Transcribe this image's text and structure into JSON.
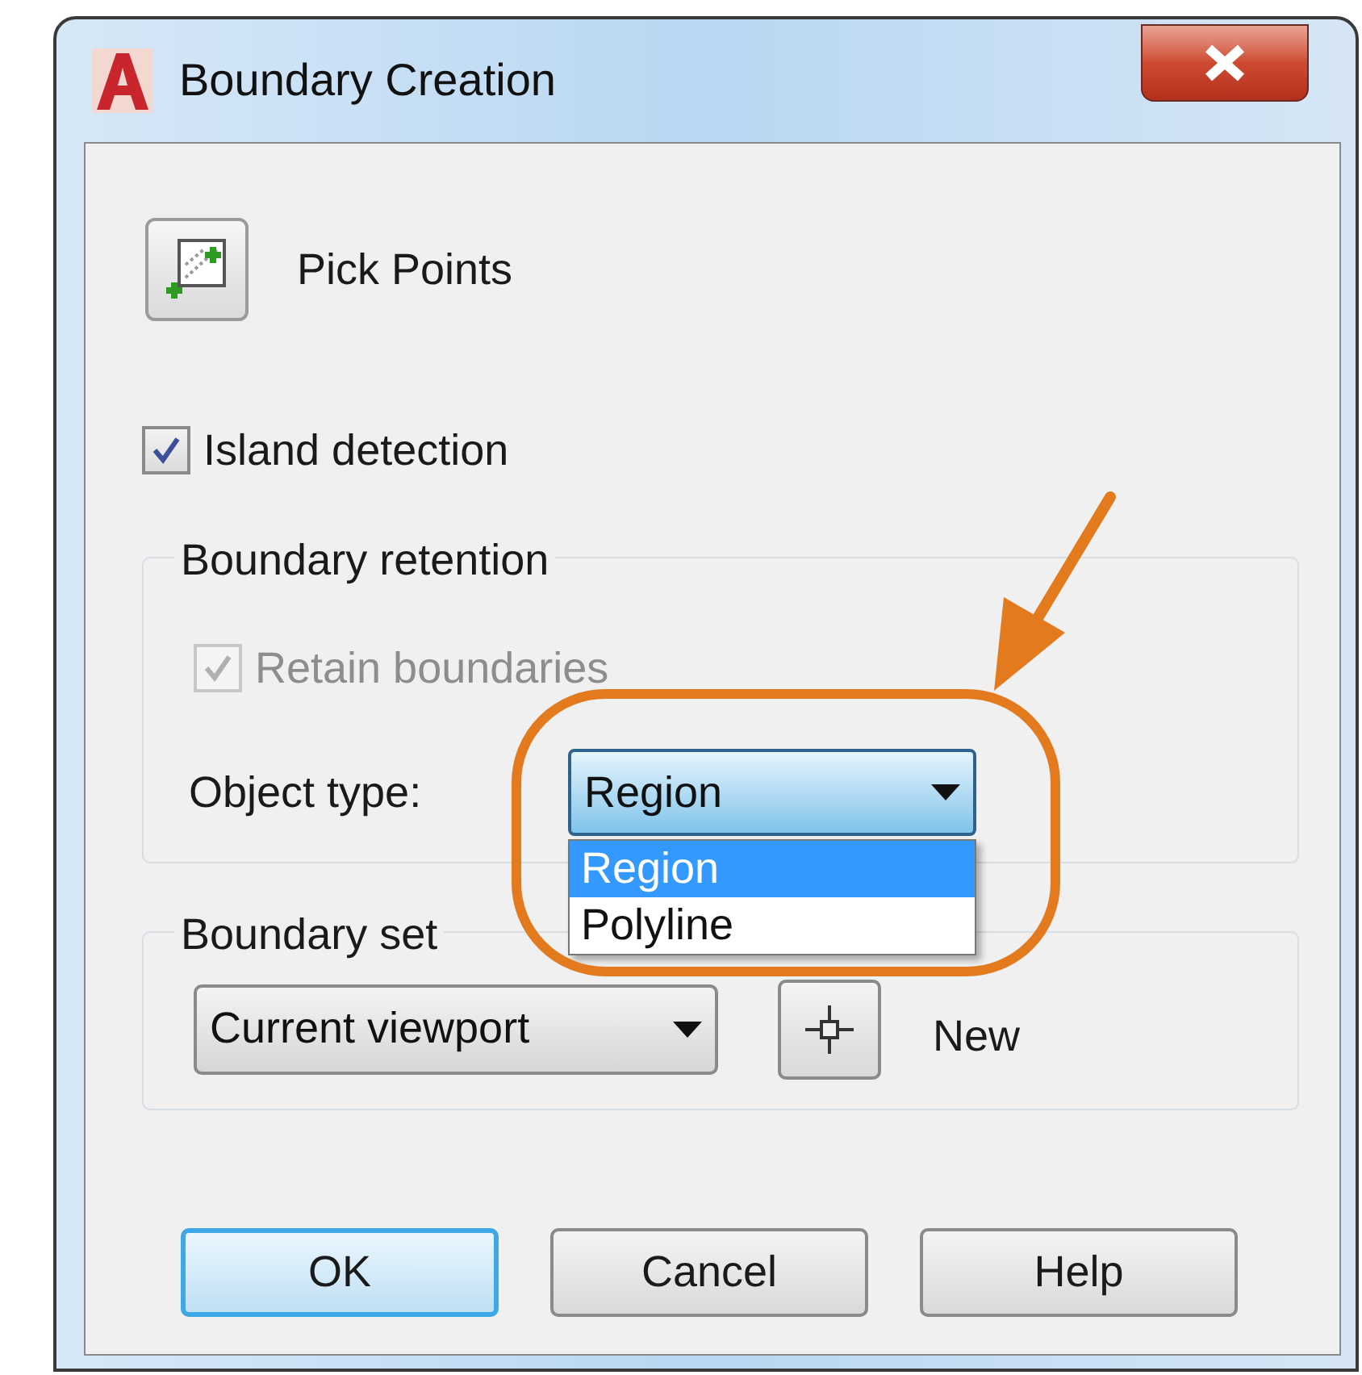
{
  "window": {
    "title": "Boundary Creation"
  },
  "pick_points": {
    "label": "Pick Points"
  },
  "island_detection": {
    "label": "Island detection",
    "checked": true,
    "disabled": false
  },
  "boundary_retention": {
    "title": "Boundary retention",
    "retain_boundaries": {
      "label": "Retain boundaries",
      "checked": true,
      "disabled": true
    },
    "object_type": {
      "label": "Object type:",
      "value": "Region",
      "expanded": true,
      "options": [
        {
          "label": "Region",
          "selected": true
        },
        {
          "label": "Polyline",
          "selected": false
        }
      ]
    }
  },
  "boundary_set": {
    "title": "Boundary set",
    "value": "Current viewport",
    "new_label": "New"
  },
  "buttons": [
    {
      "label": "OK",
      "default": true
    },
    {
      "label": "Cancel",
      "default": false
    },
    {
      "label": "Help",
      "default": false
    }
  ]
}
